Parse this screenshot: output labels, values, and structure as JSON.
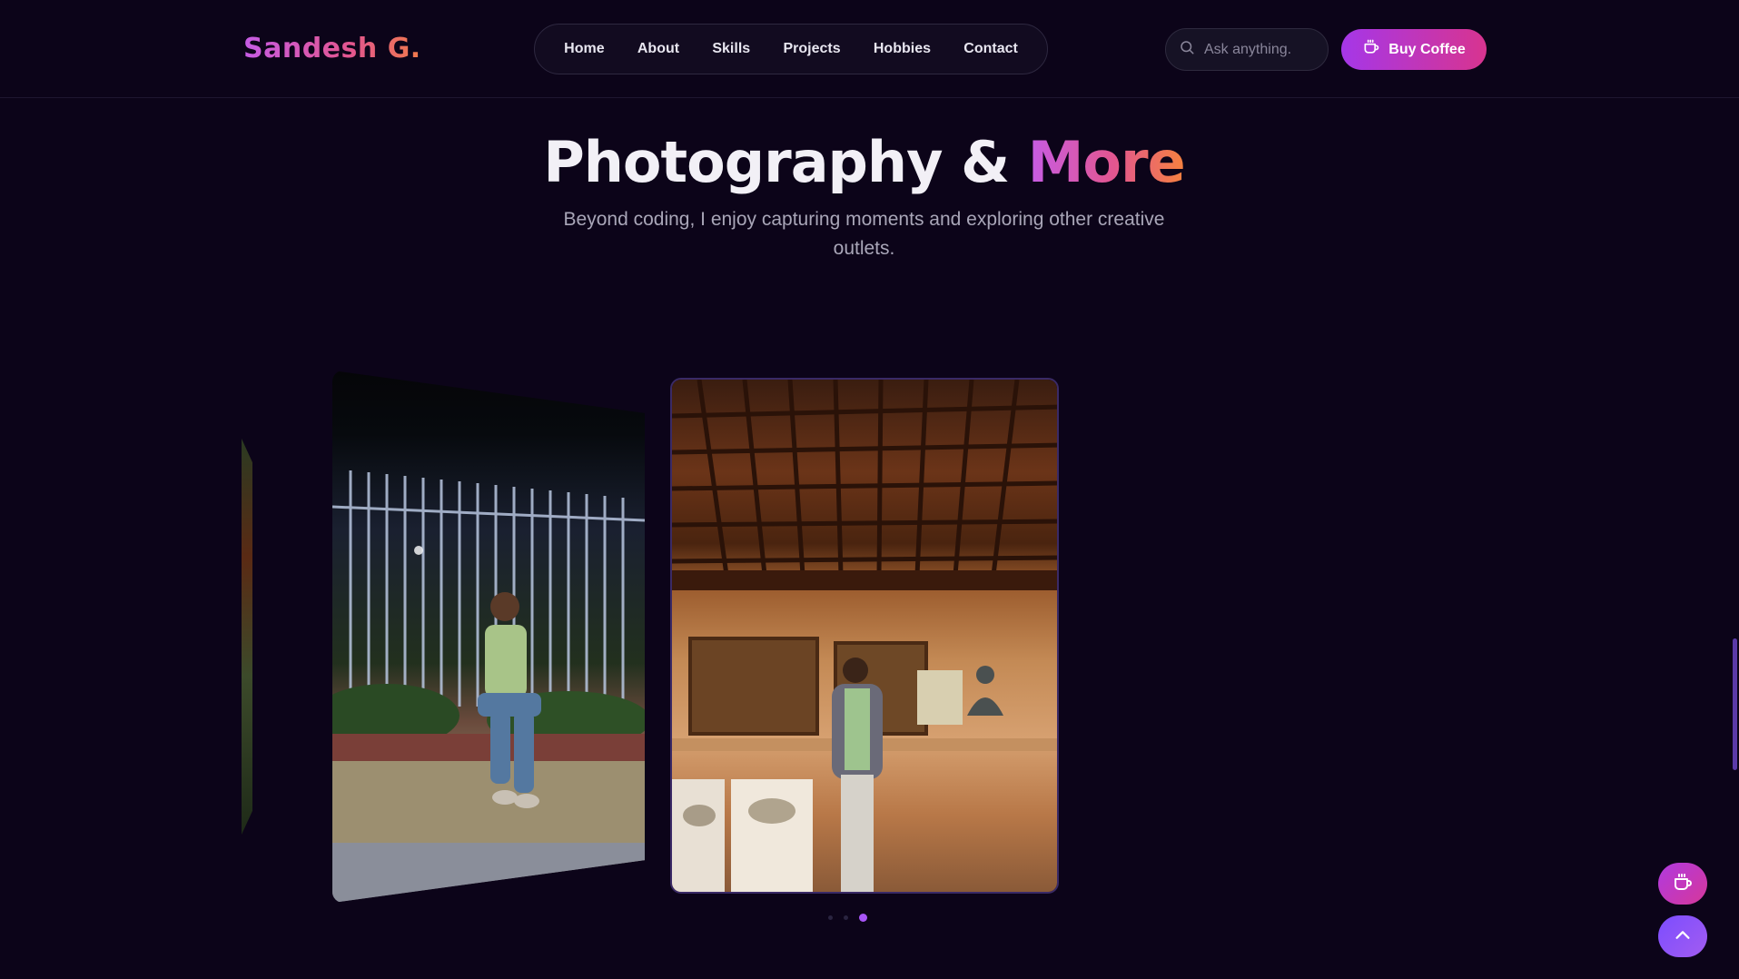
{
  "header": {
    "logo": "Sandesh G.",
    "nav": [
      "Home",
      "About",
      "Skills",
      "Projects",
      "Hobbies",
      "Contact"
    ],
    "search_placeholder": "Ask anything.",
    "coffee_label": "Buy Coffee"
  },
  "section": {
    "title_main": "Photography &",
    "title_accent": "More",
    "subtitle": "Beyond coding, I enjoy capturing moments and exploring other creative outlets."
  },
  "carousel": {
    "slides": [
      "night-fence-photo",
      "museum-photo"
    ],
    "dot_count": 3,
    "active_dot": 3
  },
  "colors": {
    "background": "#0c0419",
    "accent_purple": "#a855f7",
    "accent_pink": "#e3568f",
    "accent_orange": "#f5823e"
  },
  "icons": [
    "search-icon",
    "coffee-cup-icon",
    "chevron-up-icon"
  ]
}
